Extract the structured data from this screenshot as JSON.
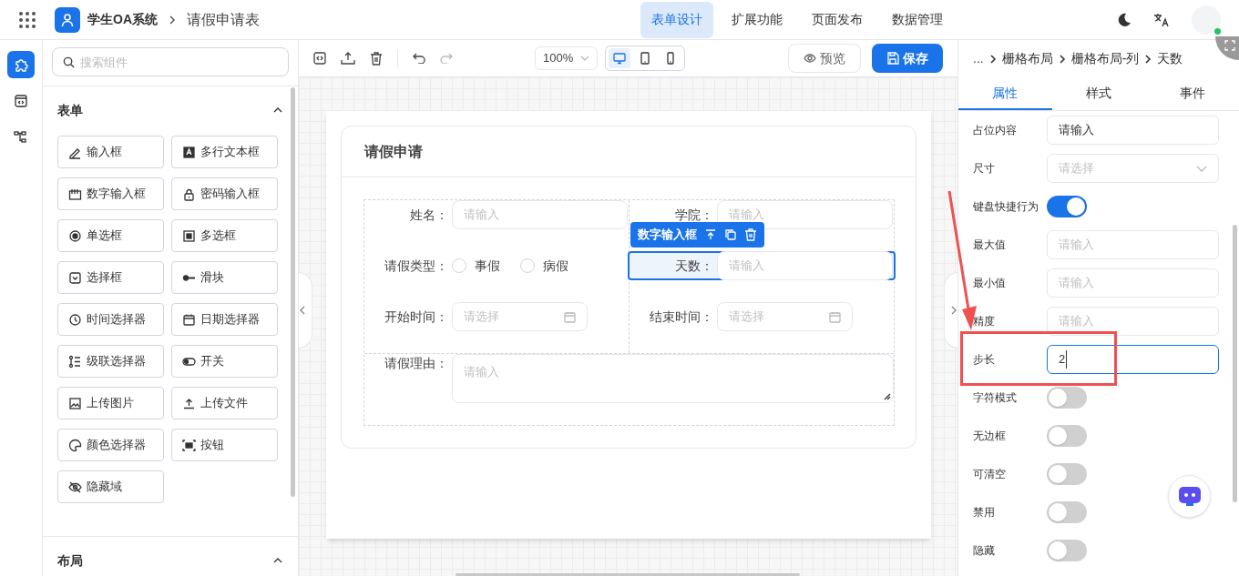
{
  "header": {
    "app_name": "学生OA系统",
    "page_title": "请假申请表",
    "nav": [
      {
        "label": "表单设计",
        "selected": true
      },
      {
        "label": "扩展功能",
        "selected": false
      },
      {
        "label": "页面发布",
        "selected": false
      },
      {
        "label": "数据管理",
        "selected": false
      }
    ]
  },
  "rail": [
    {
      "selected": true
    },
    {
      "selected": false
    },
    {
      "selected": false
    }
  ],
  "components": {
    "search_placeholder": "搜索组件",
    "sections": [
      {
        "title": "表单",
        "expanded": true,
        "items": [
          "输入框",
          "多行文本框",
          "数字输入框",
          "密码输入框",
          "单选框",
          "多选框",
          "选择框",
          "滑块",
          "时间选择器",
          "日期选择器",
          "级联选择器",
          "开关",
          "上传图片",
          "上传文件",
          "颜色选择器",
          "按钮",
          "隐藏域"
        ]
      },
      {
        "title": "布局",
        "expanded": true
      }
    ]
  },
  "toolbar": {
    "zoom": "100%",
    "devices": [
      {
        "selected": true
      },
      {
        "selected": false
      },
      {
        "selected": false
      }
    ],
    "preview": "预览",
    "save": "保存"
  },
  "form": {
    "title": "请假申请",
    "rows": [
      [
        {
          "label": "姓名：",
          "kind": "input",
          "placeholder": "请输入",
          "selected": false
        },
        {
          "label": "学院：",
          "kind": "input",
          "placeholder": "请输入",
          "selected": false
        }
      ],
      [
        {
          "label": "请假类型：",
          "kind": "radio",
          "options": [
            "事假",
            "病假"
          ],
          "selected": false
        },
        {
          "label": "天数：",
          "kind": "input",
          "placeholder": "请输入",
          "selected": true,
          "tag": "数字输入框"
        }
      ],
      [
        {
          "label": "开始时间：",
          "kind": "date",
          "placeholder": "请选择",
          "selected": false
        },
        {
          "label": "结束时间：",
          "kind": "date",
          "placeholder": "请选择",
          "selected": false
        }
      ]
    ],
    "wide": {
      "label": "请假理由：",
      "kind": "textarea",
      "placeholder": "请输入"
    }
  },
  "inspector": {
    "breadcrumb": [
      "...",
      "栅格布局",
      "栅格布局-列",
      "天数"
    ],
    "tabs": [
      {
        "label": "属性",
        "selected": true
      },
      {
        "label": "样式",
        "selected": false
      },
      {
        "label": "事件",
        "selected": false
      }
    ],
    "props": [
      {
        "label": "占位内容",
        "kind": "input",
        "value": "请输入"
      },
      {
        "label": "尺寸",
        "kind": "select",
        "placeholder": "请选择"
      },
      {
        "label": "键盘快捷行为",
        "kind": "switch",
        "on": true
      },
      {
        "label": "最大值",
        "kind": "input",
        "placeholder": "请输入"
      },
      {
        "label": "最小值",
        "kind": "input",
        "placeholder": "请输入"
      },
      {
        "label": "精度",
        "kind": "input",
        "placeholder": "请输入"
      },
      {
        "label": "步长",
        "kind": "input",
        "value": "2",
        "focused": true,
        "annotated": true
      },
      {
        "label": "字符模式",
        "kind": "switch",
        "on": false
      },
      {
        "label": "无边框",
        "kind": "switch",
        "on": false
      },
      {
        "label": "可清空",
        "kind": "switch",
        "on": false
      },
      {
        "label": "禁用",
        "kind": "switch",
        "on": false
      },
      {
        "label": "隐藏",
        "kind": "switch",
        "on": false
      }
    ]
  }
}
